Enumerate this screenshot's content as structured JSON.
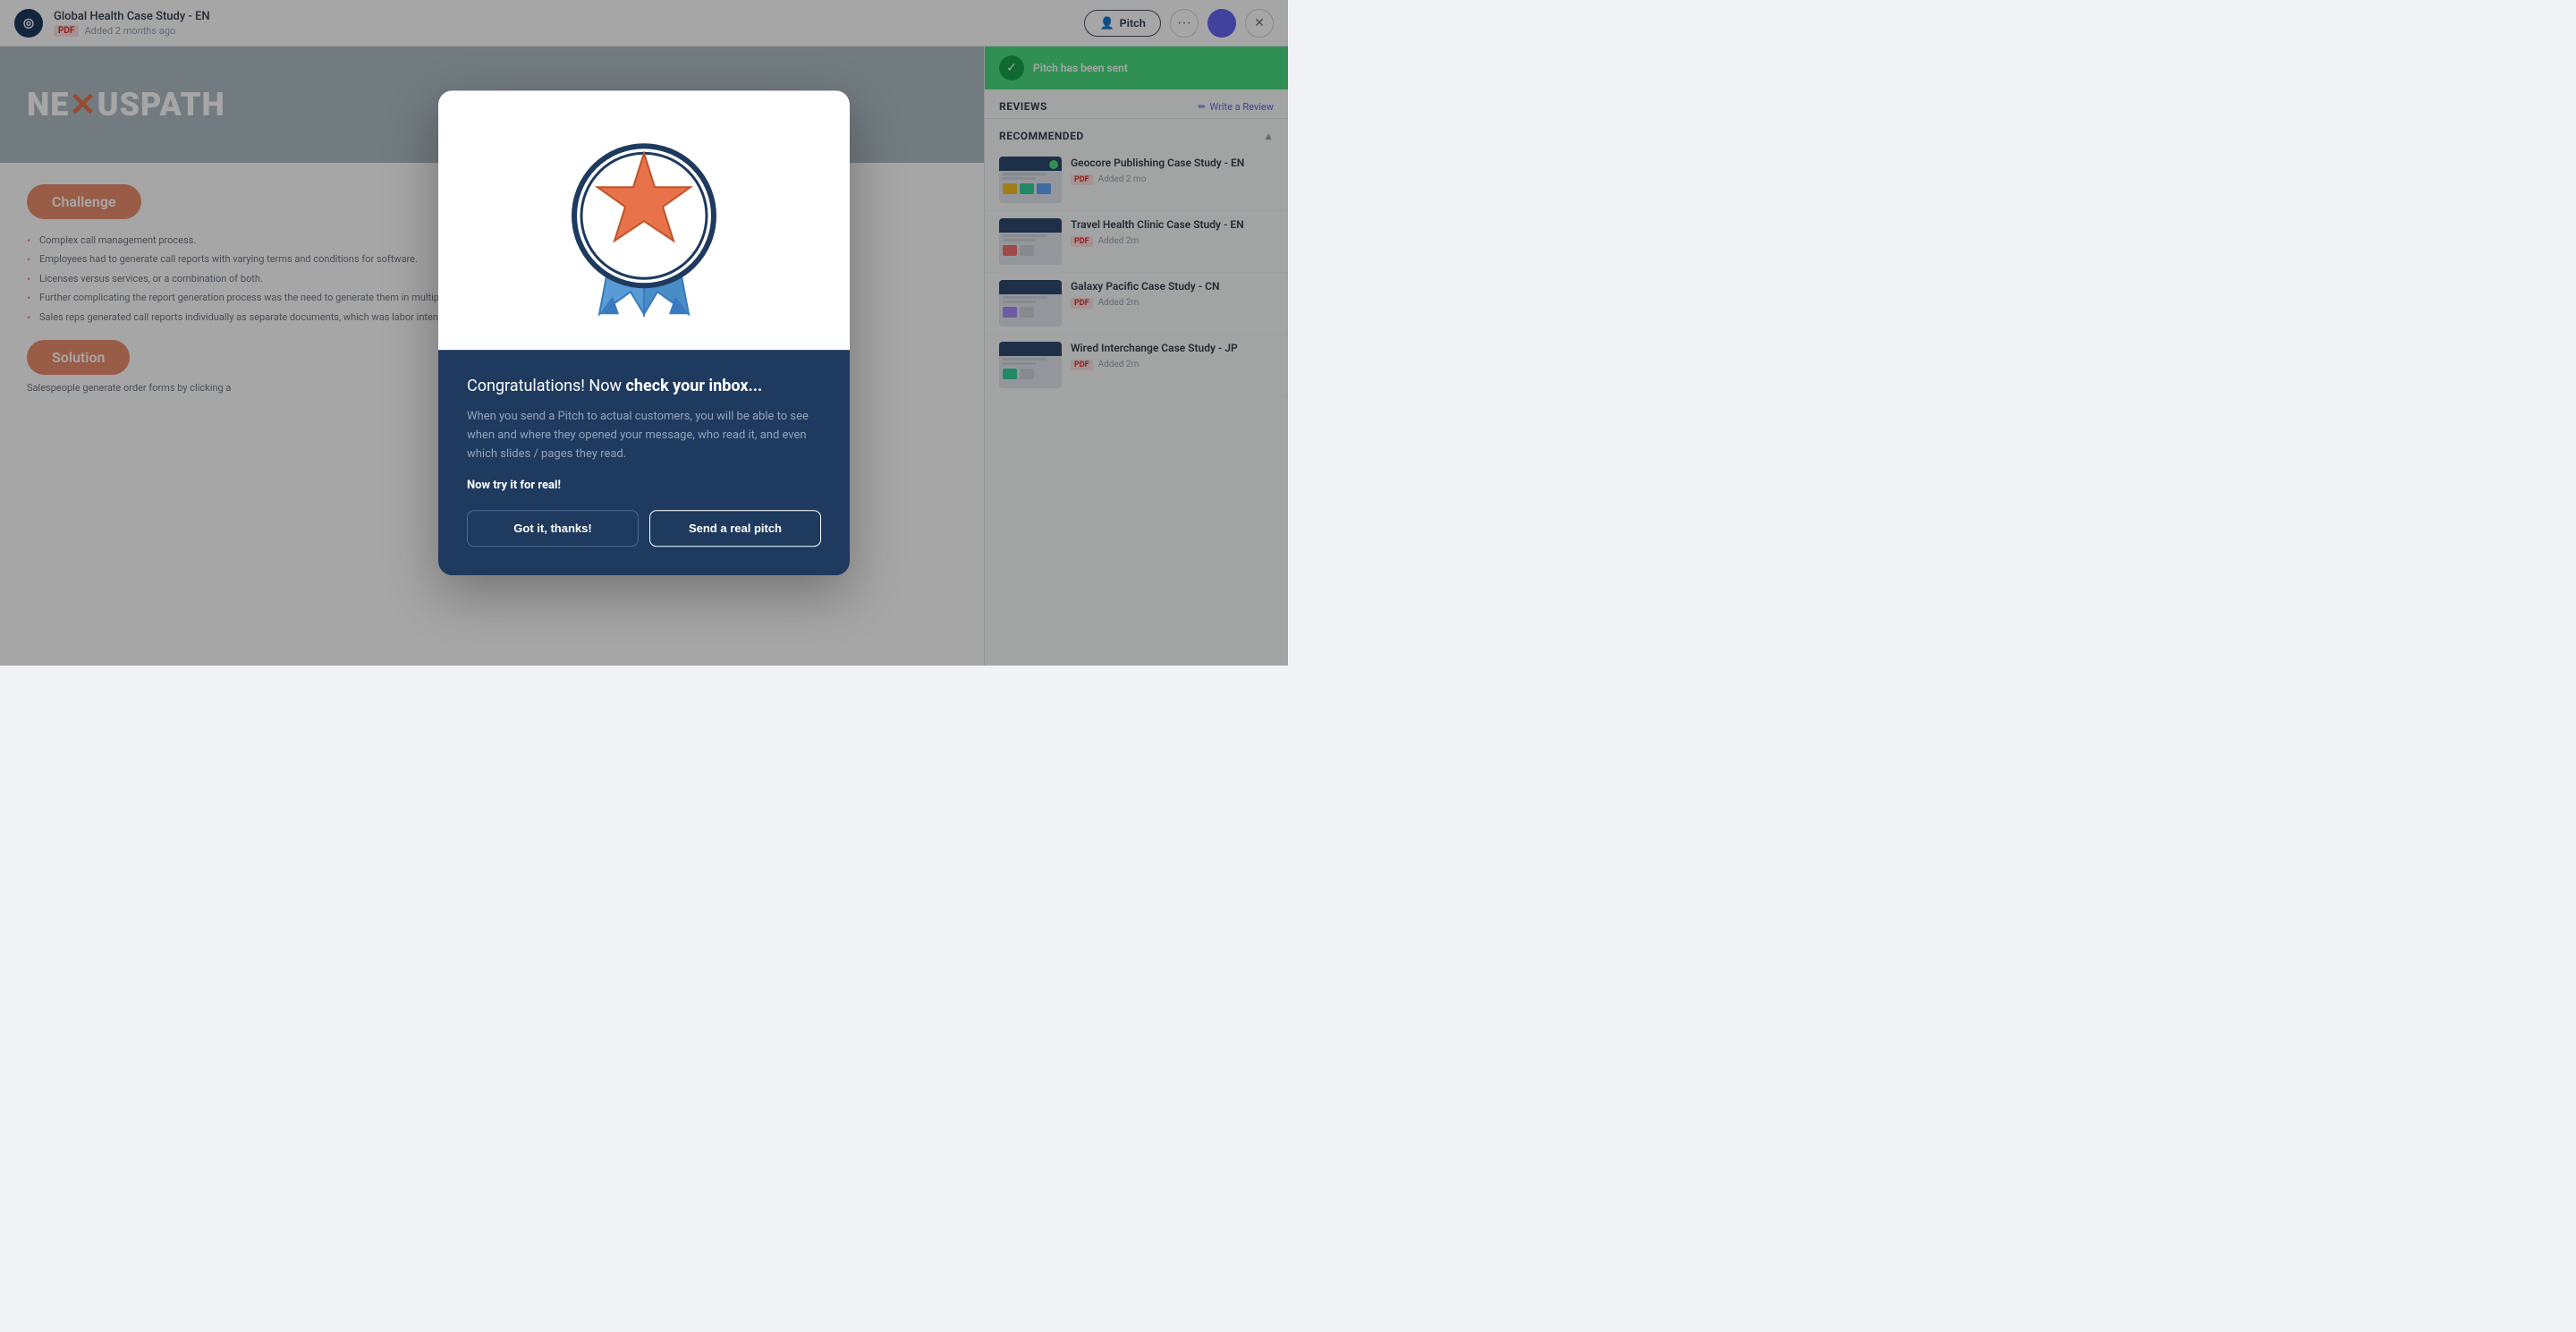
{
  "topBar": {
    "logoText": "◎",
    "title": "Global Health Case Study - EN",
    "pdfBadge": "PDF",
    "addedText": "Added 2 months ago",
    "pitchButtonLabel": "Pitch",
    "moreButtonLabel": "···"
  },
  "pitchSent": {
    "message": "Pitch has been sent"
  },
  "reviews": {
    "title": "REVIEWS",
    "writeReviewLabel": "Write a Review"
  },
  "recommended": {
    "title": "RECOMMENDED",
    "collapseLabel": "▲",
    "items": [
      {
        "title": "Geocore Publishing Case Study - EN",
        "pdfBadge": "PDF",
        "addedText": "Added 2 mo"
      },
      {
        "title": "Travel Health Clinic Case Study - EN",
        "pdfBadge": "PDF",
        "addedText": "Added 2m"
      },
      {
        "title": "Galaxy Pacific Case Study - CN",
        "pdfBadge": "PDF",
        "addedText": "Added 2m"
      },
      {
        "title": "Wired Interchange Case Study - JP",
        "pdfBadge": "PDF",
        "addedText": "Added 2m"
      }
    ]
  },
  "document": {
    "logoText": "NEXUSPATH",
    "challengeLabel": "Challenge",
    "bullets": [
      "Complex call management process.",
      "Employees had to generate call reports with varying terms and conditions for software.",
      "Licenses versus services, or a combination of both.",
      "Further complicating the report generation process was the need to generate them in multiple languages, depending on where the client was located.",
      "Sales reps generated call reports individually as separate documents, which was labor intensive, error prone and lead to branding discrepancies."
    ],
    "solutionLabel": "Solution",
    "solutionText": "Salespeople generate order forms by clicking a"
  },
  "modal": {
    "congratsText": "Congratulations! Now ",
    "congratsBold": "check your inbox...",
    "description": "When you send a Pitch to actual customers, you will be able to see when and where they opened your message, who read it, and even which slides / pages they read.",
    "ctaText": "Now try it for real!",
    "gotItLabel": "Got it, thanks!",
    "sendRealPitchLabel": "Send a real pitch"
  }
}
